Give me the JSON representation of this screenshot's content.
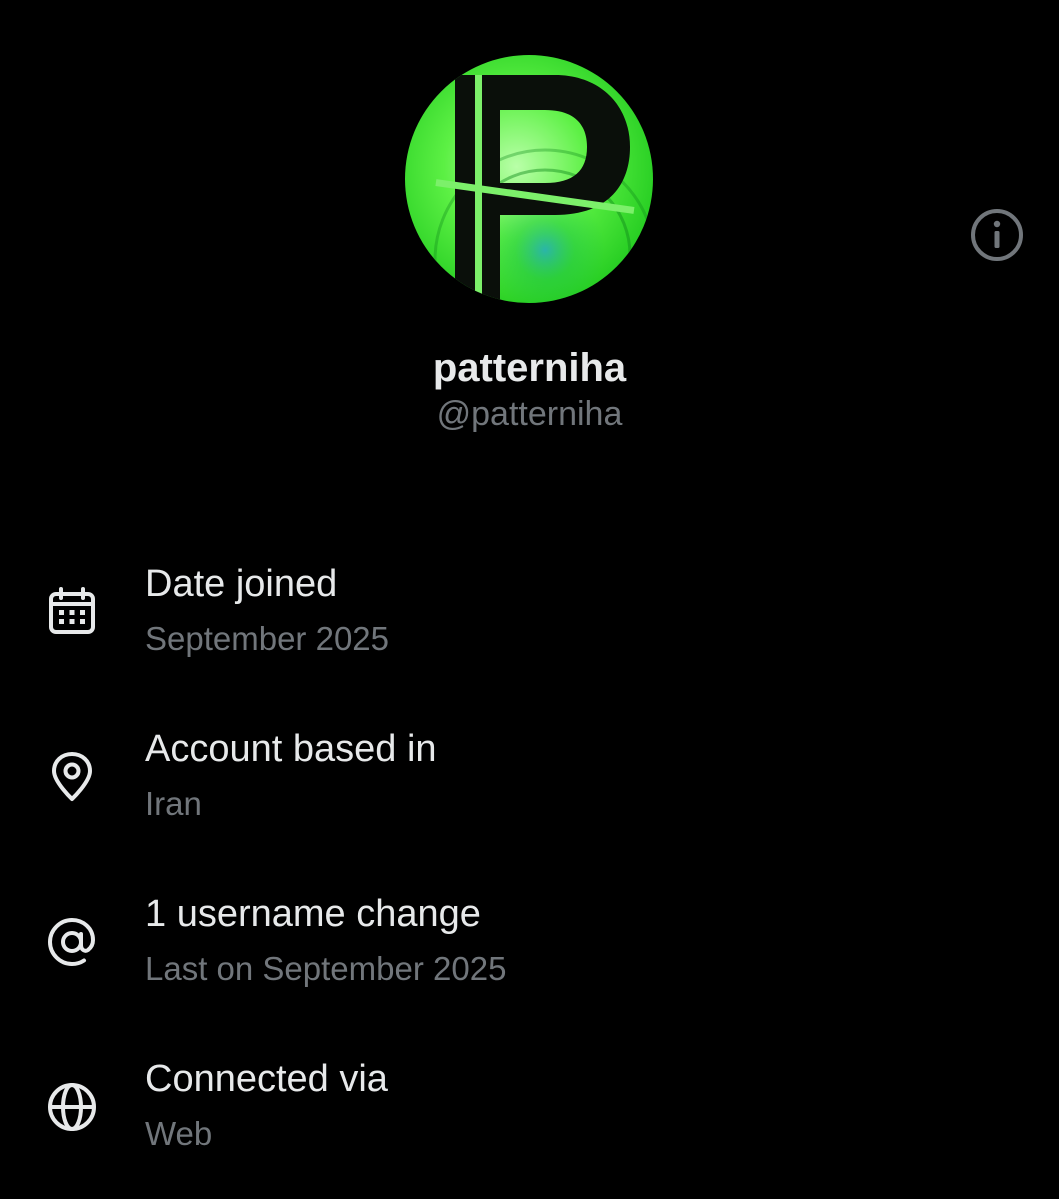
{
  "profile": {
    "display_name": "patterniha",
    "handle": "@patterniha"
  },
  "about_rows": [
    {
      "icon": "calendar-icon",
      "title": "Date joined",
      "subtitle": "September 2025"
    },
    {
      "icon": "location-pin-icon",
      "title": "Account based in",
      "subtitle": "Iran",
      "action_icon": "info-icon"
    },
    {
      "icon": "at-sign-icon",
      "title": "1 username change",
      "subtitle": "Last on September 2025"
    },
    {
      "icon": "globe-icon",
      "title": "Connected via",
      "subtitle": "Web"
    }
  ],
  "colors": {
    "background": "#000000",
    "primary_text": "#e7e9ea",
    "secondary_text": "#71767b",
    "avatar_green": "#39e639"
  }
}
